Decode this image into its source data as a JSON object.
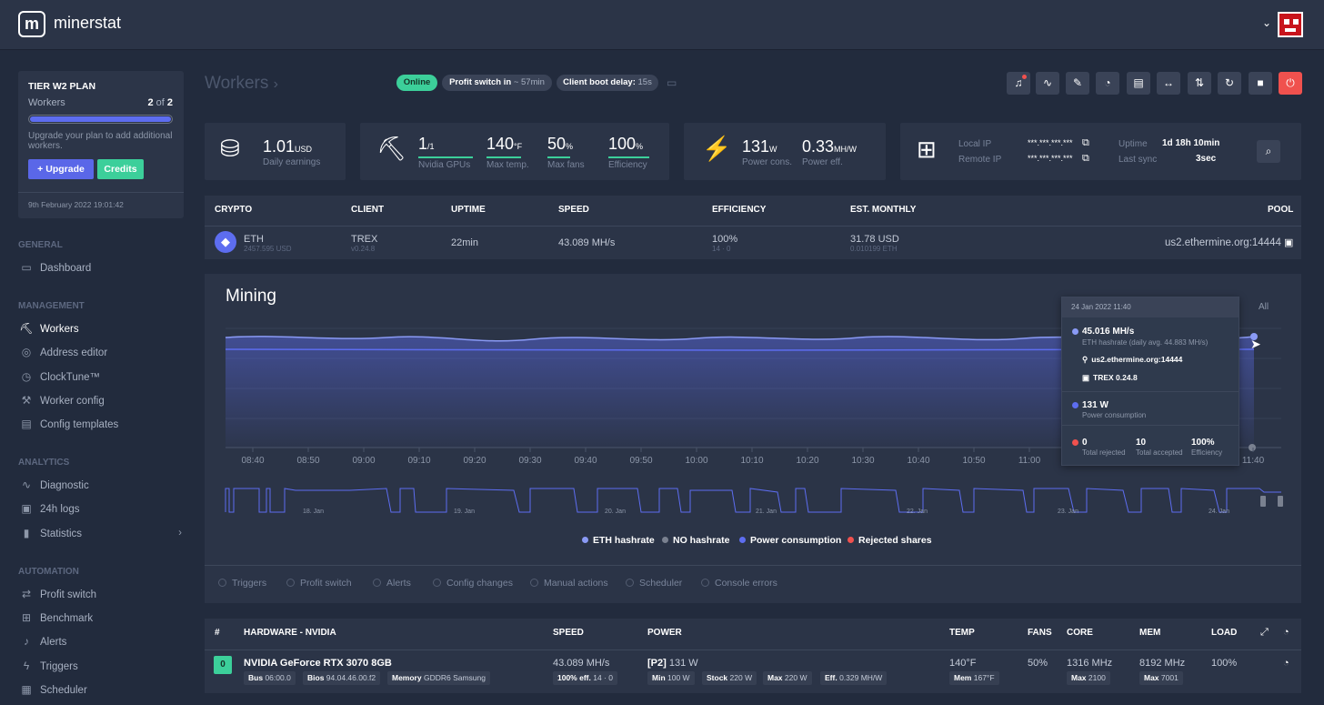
{
  "brand": {
    "logo_letter": "m",
    "name": "minerstat"
  },
  "plan": {
    "title": "TIER W2 PLAN",
    "workers_label": "Workers",
    "workers_count": "2",
    "workers_of": "of",
    "workers_total": "2",
    "workers_fill": 1.0,
    "note": "Upgrade your plan to add additional workers.",
    "upgrade_label": "Upgrade",
    "credits_label": "Credits",
    "date": "9th February 2022 19:01:42"
  },
  "nav": {
    "general": "GENERAL",
    "dashboard": "Dashboard",
    "management": "MANAGEMENT",
    "workers": "Workers",
    "address_editor": "Address editor",
    "clocktune": "ClockTune™",
    "worker_config": "Worker config",
    "config_templates": "Config templates",
    "analytics": "ANALYTICS",
    "diagnostic": "Diagnostic",
    "logs": "24h logs",
    "statistics": "Statistics",
    "automation": "AUTOMATION",
    "profit_switch": "Profit switch",
    "benchmark": "Benchmark",
    "alerts": "Alerts",
    "triggers": "Triggers",
    "scheduler": "Scheduler"
  },
  "header": {
    "title": "Workers",
    "breadcrumb_arrow": "›",
    "status": "Online",
    "profit_label": "Profit switch in",
    "profit_value": "~ 57min",
    "boot_label": "Client boot delay:",
    "boot_value": "15s"
  },
  "stats": {
    "earnings_value": "1.01",
    "earnings_unit": "USD",
    "earnings_label": "Daily earnings",
    "gpus_value": "1",
    "gpus_unit": "/1",
    "gpus_label": "Nvidia GPUs",
    "temp_value": "140",
    "temp_unit": "°F",
    "temp_label": "Max temp.",
    "fans_value": "50",
    "fans_unit": "%",
    "fans_label": "Max fans",
    "eff_value": "100",
    "eff_unit": "%",
    "eff_label": "Efficiency",
    "power_value": "131",
    "power_unit": "W",
    "power_label": "Power cons.",
    "peff_value": "0.33",
    "peff_unit": "MH/W",
    "peff_label": "Power eff.",
    "local_ip_label": "Local IP",
    "local_ip": "***.***.***.***",
    "remote_ip_label": "Remote IP",
    "remote_ip": "***.***.***.***",
    "uptime_label": "Uptime",
    "uptime": "1d 18h 10min",
    "sync_label": "Last sync",
    "sync": "3sec"
  },
  "crypto_table": {
    "headers": [
      "CRYPTO",
      "CLIENT",
      "UPTIME",
      "SPEED",
      "EFFICIENCY",
      "EST. MONTHLY",
      "POOL"
    ],
    "row": {
      "coin": "ETH",
      "coin_price": "2457.595 USD",
      "client": "TREX",
      "client_ver": "v0.24.8",
      "uptime": "22min",
      "speed": "43.089 MH/s",
      "efficiency": "100%",
      "efficiency_sub": "14 · 0",
      "monthly": "31.78 USD",
      "monthly_sub": "0.010199 ETH",
      "pool": "us2.ethermine.org:14444"
    }
  },
  "mining": {
    "title": "Mining",
    "range_partial": "d",
    "range_all": "All",
    "x_ticks": [
      "08:40",
      "08:50",
      "09:00",
      "09:10",
      "09:20",
      "09:30",
      "09:40",
      "09:50",
      "10:00",
      "10:10",
      "10:20",
      "10:30",
      "10:40",
      "10:50",
      "11:00",
      "11:40"
    ],
    "overview_dates": [
      "18. Jan",
      "19. Jan",
      "20. Jan",
      "21. Jan",
      "22. Jan",
      "23. Jan",
      "24. Jan"
    ],
    "legend": [
      {
        "label": "ETH hashrate",
        "color": "#8a9af5"
      },
      {
        "label": "NO hashrate",
        "color": "#7a8190"
      },
      {
        "label": "Power consumption",
        "color": "#5d6df0"
      },
      {
        "label": "Rejected shares",
        "color": "#f0514e"
      }
    ],
    "events": [
      "Triggers",
      "Profit switch",
      "Alerts",
      "Config changes",
      "Manual actions",
      "Scheduler",
      "Console errors"
    ],
    "tooltip": {
      "date": "24 Jan 2022 11:40",
      "hashrate": "45.016 MH/s",
      "hashrate_sub": "ETH hashrate (daily avg. 44.883 MH/s)",
      "pool": "us2.ethermine.org:14444",
      "client": "TREX 0.24.8",
      "power": "131 W",
      "power_sub": "Power consumption",
      "rejected": "0",
      "rejected_label": "Total rejected",
      "accepted": "10",
      "accepted_label": "Total accepted",
      "efficiency": "100%",
      "efficiency_label": "Efficiency"
    }
  },
  "hw_table": {
    "headers": [
      "#",
      "HARDWARE - NVIDIA",
      "SPEED",
      "POWER",
      "TEMP",
      "FANS",
      "CORE",
      "MEM",
      "LOAD"
    ],
    "row": {
      "index": "0",
      "name": "NVIDIA GeForce RTX 3070 8GB",
      "bus_label": "Bus",
      "bus": "06:00.0",
      "bios_label": "Bios",
      "bios": "94.04.46.00.f2",
      "memory_label": "Memory",
      "memory": "GDDR6 Samsung",
      "speed": "43.089 MH/s",
      "speed_eff": "100% eff.",
      "speed_eff_sub": "14 · 0",
      "power_state": "[P2]",
      "power": "131 W",
      "min_label": "Min",
      "min": "100 W",
      "stock_label": "Stock",
      "stock": "220 W",
      "max_label": "Max",
      "max": "220 W",
      "eff_label": "Eff.",
      "eff": "0.329 MH/W",
      "temp": "140°F",
      "mem_temp_label": "Mem",
      "mem_temp": "167°F",
      "fans": "50%",
      "core": "1316 MHz",
      "core_max_label": "Max",
      "core_max": "2100",
      "mem": "8192 MHz",
      "mem_max_label": "Max",
      "mem_max": "7001",
      "load": "100%"
    }
  }
}
